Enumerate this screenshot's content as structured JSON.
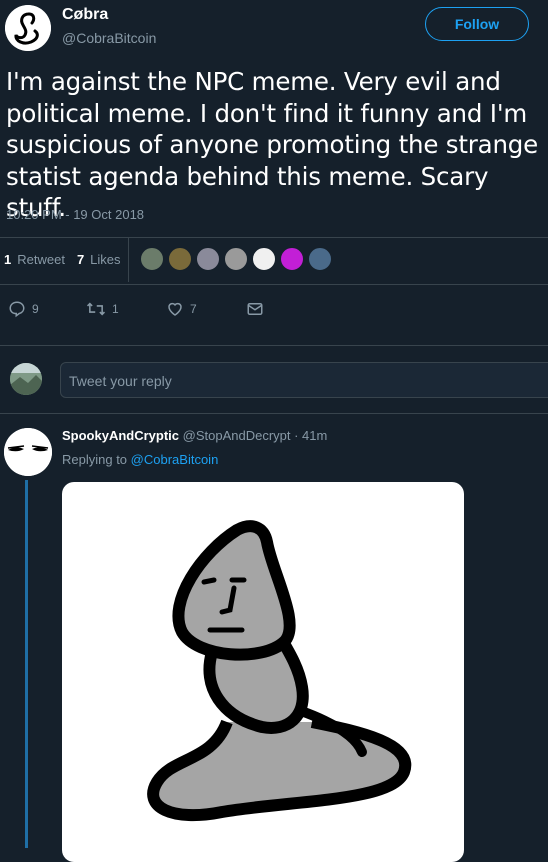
{
  "author": {
    "name": "Cøbra",
    "handle": "@CobraBitcoin",
    "follow_label": "Follow"
  },
  "tweet": {
    "text": "I'm against the NPC meme. Very evil and political meme. I don't find it funny and I'm suspicious of anyone promoting the strange statist agenda behind this meme. Scary stuff.",
    "timestamp": "10:20 PM - 19 Oct 2018"
  },
  "stats": {
    "retweets_count": "1",
    "retweets_label": "Retweet",
    "likes_count": "7",
    "likes_label": "Likes"
  },
  "actions": {
    "reply_count": "9",
    "retweet_count": "1",
    "like_count": "7"
  },
  "reply_box": {
    "placeholder": "Tweet your reply"
  },
  "reply": {
    "name": "SpookyAndCryptic",
    "handle_time": "@StopAndDecrypt · 41m",
    "replying_prefix": "Replying to",
    "replying_handle": "@CobraBitcoin"
  },
  "icons": {
    "reply": "reply-icon",
    "retweet": "retweet-icon",
    "like": "heart-icon",
    "dm": "envelope-icon"
  },
  "colors": {
    "background": "#15202b",
    "accent": "#1da1f2",
    "muted": "#8899a6",
    "divider": "#38444d"
  }
}
